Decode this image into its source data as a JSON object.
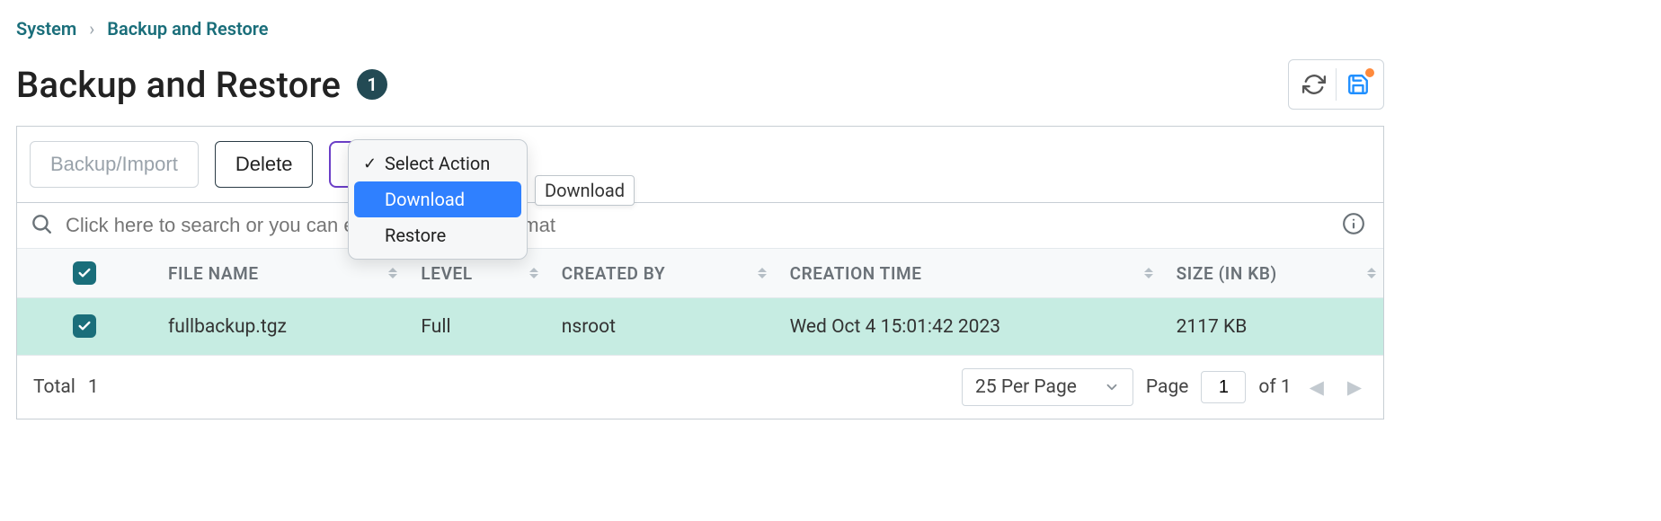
{
  "breadcrumb": {
    "root": "System",
    "current": "Backup and Restore"
  },
  "title": "Backup and Restore",
  "badge_count": "1",
  "toolbar": {
    "backup_import": "Backup/Import",
    "delete": "Delete",
    "select_action": "Select Action"
  },
  "menu": {
    "select_action": "Select Action",
    "download": "Download",
    "restore": "Restore"
  },
  "tooltip": "Download",
  "search": {
    "placeholder": "Click here to search or you can enter Key : Value format"
  },
  "columns": {
    "file_name": "FILE NAME",
    "level": "LEVEL",
    "created_by": "CREATED BY",
    "creation_time": "CREATION TIME",
    "size": "SIZE (IN KB)"
  },
  "rows": [
    {
      "file_name": "fullbackup.tgz",
      "level": "Full",
      "created_by": "nsroot",
      "creation_time": "Wed Oct  4 15:01:42 2023",
      "size": "2117 KB",
      "selected": true
    }
  ],
  "footer": {
    "total_label": "Total",
    "total_value": "1",
    "per_page": "25 Per Page",
    "page_label": "Page",
    "page_value": "1",
    "of_label": "of 1"
  }
}
